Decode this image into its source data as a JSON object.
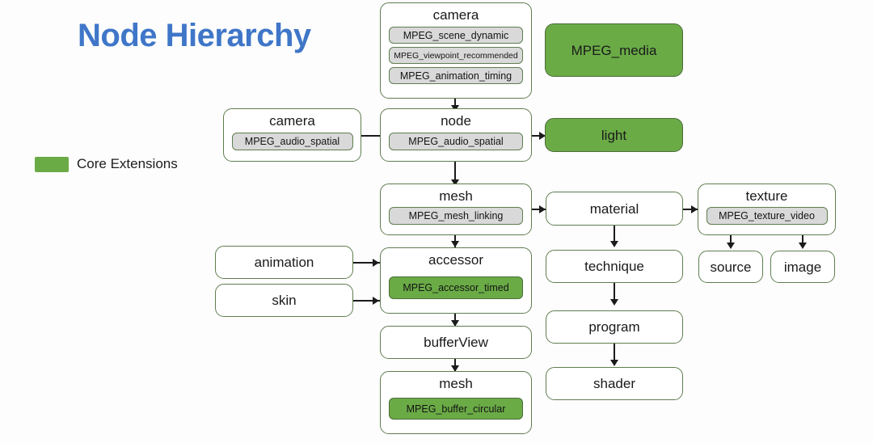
{
  "title": "Node Hierarchy",
  "legend": {
    "swatch_color": "#6aab46",
    "label": "Core Extensions"
  },
  "colors": {
    "title_blue": "#3f76c8",
    "core_extension_green": "#6aab46",
    "box_border": "#5f7d4f",
    "chip_gray": "#d9d9d9",
    "connector": "#1b1b1b"
  },
  "nodes": {
    "camera_top": {
      "title": "camera",
      "extensions": [
        "MPEG_scene_dynamic",
        "MPEG_viewpoint_recommended",
        "MPEG_animation_timing"
      ]
    },
    "mpeg_media": {
      "title": "MPEG_media",
      "core": true
    },
    "camera_left": {
      "title": "camera",
      "extensions": [
        "MPEG_audio_spatial"
      ]
    },
    "node": {
      "title": "node",
      "extensions": [
        "MPEG_audio_spatial"
      ]
    },
    "light": {
      "title": "light",
      "core": true
    },
    "mesh": {
      "title": "mesh",
      "extensions": [
        "MPEG_mesh_linking"
      ]
    },
    "material": {
      "title": "material"
    },
    "texture": {
      "title": "texture",
      "extensions": [
        "MPEG_texture_video"
      ]
    },
    "animation": {
      "title": "animation"
    },
    "skin": {
      "title": "skin"
    },
    "accessor": {
      "title": "accessor",
      "extensions": [
        "MPEG_accessor_timed"
      ],
      "extension_is_core": true
    },
    "technique": {
      "title": "technique"
    },
    "source": {
      "title": "source"
    },
    "image": {
      "title": "image"
    },
    "bufferview": {
      "title": "bufferView"
    },
    "program": {
      "title": "program"
    },
    "mesh_buffer": {
      "title": "mesh",
      "extensions": [
        "MPEG_buffer_circular"
      ],
      "extension_is_core": true
    },
    "shader": {
      "title": "shader"
    }
  }
}
